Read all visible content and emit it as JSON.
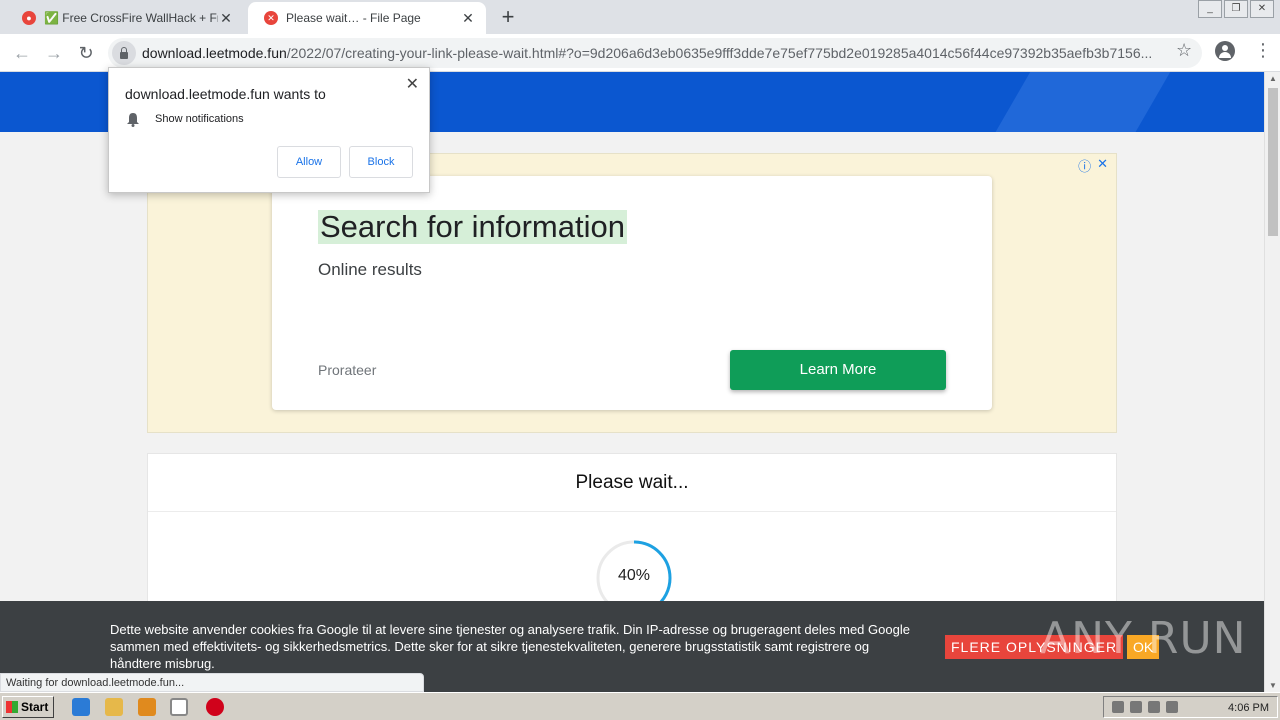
{
  "tabs": [
    {
      "title": "✅ Free CrossFire WallHack + Freeze",
      "favicon_color": "#e8453c"
    },
    {
      "title": "Please wait… - File Page",
      "favicon_color": "#e8453c"
    }
  ],
  "new_tab_symbol": "+",
  "url": {
    "host": "download.leetmode.fun",
    "path": "/2022/07/creating-your-link-please-wait.html#?o=9d206a6d3eb0635e9fff3dde7e75ef775bd2e019285a4014c56f44ce97392b35aefb3b7156..."
  },
  "popup": {
    "site_text": "download.leetmode.fun wants to",
    "permission": "Show notifications",
    "allow_label": "Allow",
    "block_label": "Block"
  },
  "ad": {
    "title": "Search for information",
    "subtitle": "Online results",
    "brand": "Prorateer",
    "cta": "Learn More"
  },
  "card": {
    "heading": "Please wait...",
    "progress_text": "40%",
    "progress_value": 0.4
  },
  "cookie": {
    "text": "Dette website anvender cookies fra Google til at levere sine tjenester og analysere trafik. Din IP-adresse og brugeragent deles med Google sammen med effektivitets- og sikkerhedsmetrics. Dette sker for at sikre tjenestekvaliteten, generere brugsstatistik samt registrere og håndtere misbrug.",
    "more_label": "FLERE OPLYSNINGER",
    "ok_label": "OK"
  },
  "watermark": "ANY RUN",
  "status_text": "Waiting for download.leetmode.fun...",
  "taskbar": {
    "start_label": "Start",
    "clock": "4:06 PM"
  },
  "colors": {
    "header_blue": "#0b57d0",
    "cta_green": "#0f9d58",
    "spinner": "#1da1e2"
  }
}
